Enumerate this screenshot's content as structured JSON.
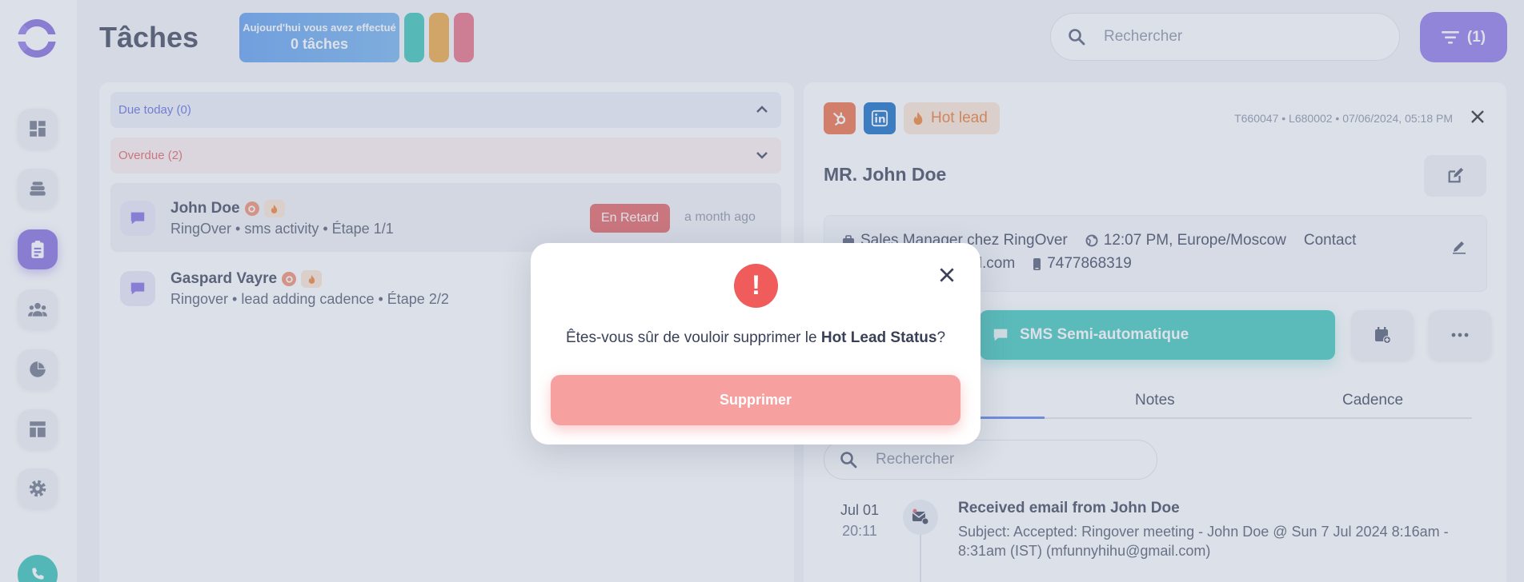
{
  "header": {
    "title": "Tâches",
    "stat_label": "Aujourd'hui vous avez effectué",
    "stat_value": "0 tâches",
    "search_placeholder": "Rechercher",
    "filter_label": "(1)"
  },
  "colors": {
    "accent": "#7f68dc",
    "pill_teal": "#34c2b6",
    "pill_orange": "#efa339",
    "pill_pink": "#e9687f",
    "danger": "#e35d5d"
  },
  "task_groups": {
    "due_today": "Due today (0)",
    "overdue": "Overdue (2)"
  },
  "tasks": [
    {
      "name": "John Doe",
      "subtitle": "RingOver • sms activity • Étape 1/1",
      "badge": "En Retard",
      "time": "a month ago"
    },
    {
      "name": "Gaspard Vayre",
      "subtitle": "Ringover • lead adding cadence • Étape 2/2"
    }
  ],
  "lead": {
    "hot_tag": "Hot lead",
    "meta": "T660047 • L680002 • 07/06/2024, 05:18 PM",
    "name": "MR. John Doe",
    "job": "Sales Manager chez RingOver",
    "local_time": "12:07 PM, Europe/Moscow",
    "contact_label": "Contact",
    "email_partial": "ail.com",
    "phone": "7477868319",
    "sms_button": "SMS Semi-automatique",
    "tabs": [
      "Notes",
      "Cadence"
    ],
    "search_placeholder": "Rechercher"
  },
  "activity": {
    "date": "Jul 01",
    "time": "20:11",
    "title": "Received email from John Doe",
    "body": "Subject: Accepted: Ringover meeting - John Doe @ Sun 7 Jul 2024 8:16am - 8:31am (IST) (mfunnyhihu@gmail.com)"
  },
  "modal": {
    "text_before": "Êtes-vous sûr de vouloir supprimer le ",
    "text_bold": "Hot Lead Status",
    "text_after": "?",
    "button": "Supprimer"
  }
}
